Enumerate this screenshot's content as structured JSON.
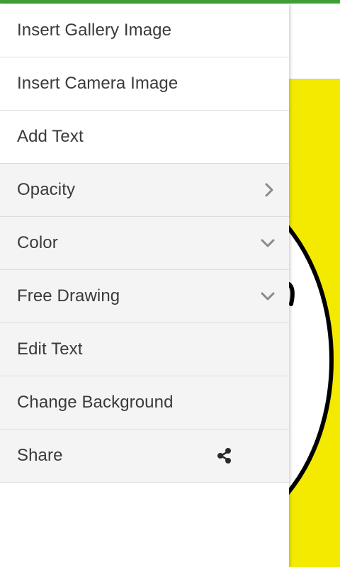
{
  "colors": {
    "accent": "#3f9e36",
    "canvas": "#f4ea00",
    "text": "#3a3a3a",
    "icon": "#8a8a8a"
  },
  "drawer": {
    "items": [
      {
        "label": "Insert Gallery Image",
        "icon": ""
      },
      {
        "label": "Insert Camera Image",
        "icon": ""
      },
      {
        "label": "Add Text",
        "icon": ""
      },
      {
        "label": "Opacity",
        "icon": "chevron-right-icon"
      },
      {
        "label": "Color",
        "icon": "chevron-down-icon"
      },
      {
        "label": "Free Drawing",
        "icon": "chevron-down-icon"
      },
      {
        "label": "Edit Text",
        "icon": ""
      },
      {
        "label": "Change Background",
        "icon": ""
      },
      {
        "label": "Share",
        "icon": "share-icon"
      }
    ]
  }
}
